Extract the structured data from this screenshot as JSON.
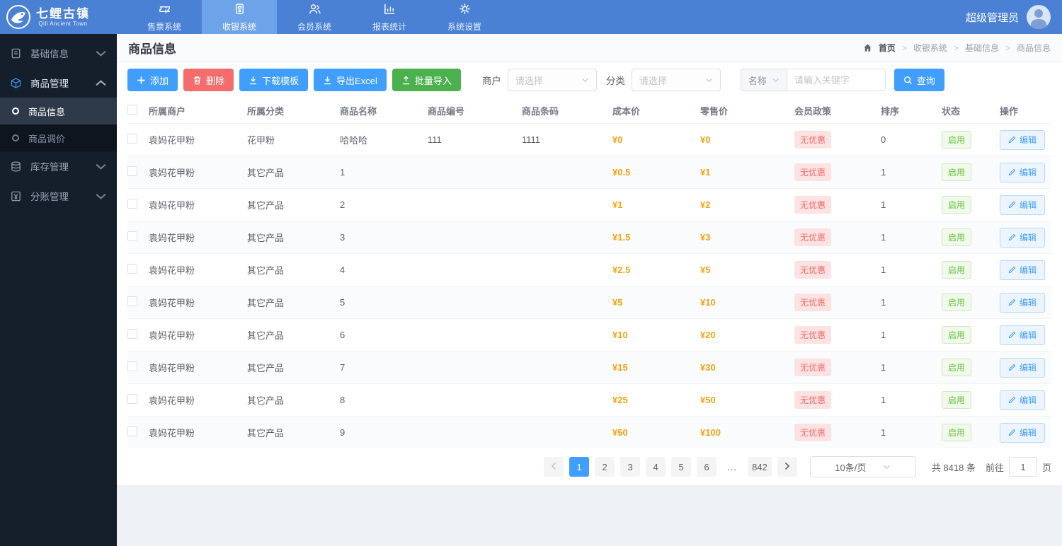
{
  "topbar": {
    "logo_title": "七鲤古镇",
    "logo_subtitle": "Qili Ancient Town",
    "menu": [
      {
        "label": "售票系统",
        "icon": "ticket-icon",
        "active": false
      },
      {
        "label": "收银系统",
        "icon": "cashier-icon",
        "active": true
      },
      {
        "label": "会员系统",
        "icon": "members-icon",
        "active": false
      },
      {
        "label": "报表统计",
        "icon": "report-chart-icon",
        "active": false
      },
      {
        "label": "系统设置",
        "icon": "gear-icon",
        "active": false
      }
    ],
    "user_name": "超级管理员"
  },
  "sidebar": {
    "items": [
      {
        "label": "基础信息",
        "icon": "document-icon",
        "expanded": false
      },
      {
        "label": "商品管理",
        "icon": "cube-icon",
        "expanded": true,
        "children": [
          {
            "label": "商品信息",
            "active": true
          },
          {
            "label": "商品调价",
            "active": false
          }
        ]
      },
      {
        "label": "库存管理",
        "icon": "inventory-icon",
        "expanded": false
      },
      {
        "label": "分账管理",
        "icon": "ledger-icon",
        "expanded": false
      }
    ]
  },
  "page": {
    "title": "商品信息",
    "breadcrumb": [
      "首页",
      "收银系统",
      "基础信息",
      "商品信息"
    ]
  },
  "toolbar": {
    "add_label": "添加",
    "delete_label": "删除",
    "download_template_label": "下载模板",
    "export_excel_label": "导出Excel",
    "batch_import_label": "批量导入"
  },
  "filters": {
    "merchant_label": "商户",
    "merchant_placeholder": "请选择",
    "category_label": "分类",
    "category_placeholder": "请选择",
    "name_label": "名称",
    "keyword_placeholder": "请输入关键字",
    "search_label": "查询"
  },
  "table": {
    "headers": [
      "所属商户",
      "所属分类",
      "商品名称",
      "商品编号",
      "商品条码",
      "成本价",
      "零售价",
      "会员政策",
      "排序",
      "状态",
      "操作"
    ],
    "edit_label": "编辑",
    "rows": [
      {
        "merchant": "袁妈花甲粉",
        "category": "花甲粉",
        "name": "哈哈哈",
        "number": "111",
        "barcode": "1111",
        "cost": "¥0",
        "retail": "¥0",
        "policy": "无优惠",
        "sort": "0",
        "status": "启用"
      },
      {
        "merchant": "袁妈花甲粉",
        "category": "其它产品",
        "name": "1",
        "number": "",
        "barcode": "",
        "cost": "¥0.5",
        "retail": "¥1",
        "policy": "无优惠",
        "sort": "1",
        "status": "启用"
      },
      {
        "merchant": "袁妈花甲粉",
        "category": "其它产品",
        "name": "2",
        "number": "",
        "barcode": "",
        "cost": "¥1",
        "retail": "¥2",
        "policy": "无优惠",
        "sort": "1",
        "status": "启用"
      },
      {
        "merchant": "袁妈花甲粉",
        "category": "其它产品",
        "name": "3",
        "number": "",
        "barcode": "",
        "cost": "¥1.5",
        "retail": "¥3",
        "policy": "无优惠",
        "sort": "1",
        "status": "启用"
      },
      {
        "merchant": "袁妈花甲粉",
        "category": "其它产品",
        "name": "4",
        "number": "",
        "barcode": "",
        "cost": "¥2.5",
        "retail": "¥5",
        "policy": "无优惠",
        "sort": "1",
        "status": "启用"
      },
      {
        "merchant": "袁妈花甲粉",
        "category": "其它产品",
        "name": "5",
        "number": "",
        "barcode": "",
        "cost": "¥5",
        "retail": "¥10",
        "policy": "无优惠",
        "sort": "1",
        "status": "启用"
      },
      {
        "merchant": "袁妈花甲粉",
        "category": "其它产品",
        "name": "6",
        "number": "",
        "barcode": "",
        "cost": "¥10",
        "retail": "¥20",
        "policy": "无优惠",
        "sort": "1",
        "status": "启用"
      },
      {
        "merchant": "袁妈花甲粉",
        "category": "其它产品",
        "name": "7",
        "number": "",
        "barcode": "",
        "cost": "¥15",
        "retail": "¥30",
        "policy": "无优惠",
        "sort": "1",
        "status": "启用"
      },
      {
        "merchant": "袁妈花甲粉",
        "category": "其它产品",
        "name": "8",
        "number": "",
        "barcode": "",
        "cost": "¥25",
        "retail": "¥50",
        "policy": "无优惠",
        "sort": "1",
        "status": "启用"
      },
      {
        "merchant": "袁妈花甲粉",
        "category": "其它产品",
        "name": "9",
        "number": "",
        "barcode": "",
        "cost": "¥50",
        "retail": "¥100",
        "policy": "无优惠",
        "sort": "1",
        "status": "启用"
      }
    ]
  },
  "pagination": {
    "pages": [
      "1",
      "2",
      "3",
      "4",
      "5",
      "6",
      "...",
      "842"
    ],
    "active_page": "1",
    "page_size": "10条/页",
    "total": "共 8418 条",
    "goto_prefix": "前往",
    "goto_value": "1",
    "goto_suffix": "页"
  },
  "colors": {
    "topbar_blue": "#4a81d4",
    "active_tab_blue": "#6da3e8",
    "primary_blue": "#409eff",
    "danger_red": "#f56c6c",
    "success_green": "#4cb04f",
    "price_orange": "#f2a312",
    "sidebar_dark": "#151e2b"
  }
}
